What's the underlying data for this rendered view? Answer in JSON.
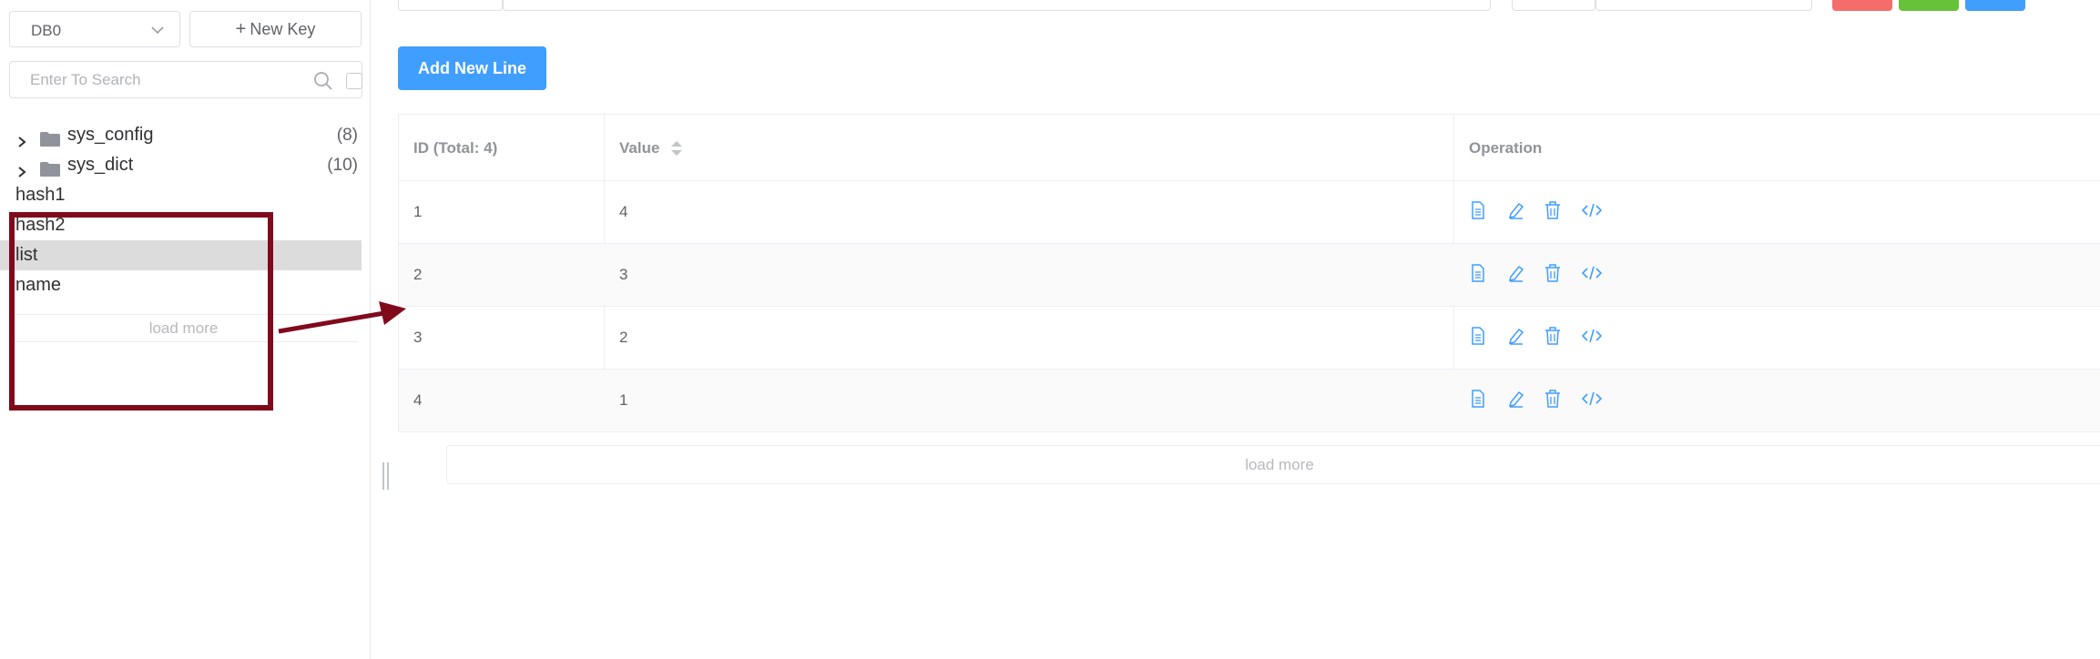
{
  "sidebar": {
    "db_select": {
      "value": "DB0"
    },
    "new_key_label": "New Key",
    "search": {
      "placeholder": "Enter To Search"
    },
    "tree": {
      "folders": [
        {
          "name": "sys_config",
          "count": "(8)"
        },
        {
          "name": "sys_dict",
          "count": "(10)"
        }
      ],
      "keys": [
        {
          "name": "hash1",
          "selected": false
        },
        {
          "name": "hash2",
          "selected": false
        },
        {
          "name": "list",
          "selected": true
        },
        {
          "name": "name",
          "selected": false
        }
      ],
      "load_more_label": "load more"
    }
  },
  "main": {
    "add_new_line_label": "Add New Line",
    "table": {
      "columns": {
        "id": "ID (Total: 4)",
        "value": "Value",
        "operation": "Operation"
      },
      "rows": [
        {
          "id": "1",
          "value": "4"
        },
        {
          "id": "2",
          "value": "3"
        },
        {
          "id": "3",
          "value": "2"
        },
        {
          "id": "4",
          "value": "1"
        }
      ]
    },
    "load_more_label": "load more"
  },
  "colors": {
    "accent": "#409eff",
    "danger": "#f56c6c",
    "success": "#67c23a",
    "annotation": "#800a1c",
    "selected_row": "#dcdcdc"
  },
  "icons": [
    "chevron-down-icon",
    "plus-icon",
    "search-icon",
    "folder-icon",
    "chevron-right-icon",
    "sort-icon",
    "view-document-icon",
    "edit-icon",
    "delete-icon",
    "code-icon"
  ]
}
